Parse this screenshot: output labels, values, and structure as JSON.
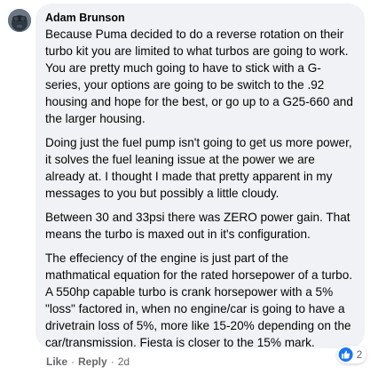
{
  "comment": {
    "author": "Adam Brunson",
    "paragraphs": [
      "Because Puma decided to do a reverse rotation on their turbo kit you are limited to what turbos are going to work. You are pretty much going to have to stick with a G-series, your options are going to be switch to the .92 housing and hope for the best, or go up to a G25-660 and the larger housing.",
      "Doing just the fuel pump isn't going to get us more power, it solves the fuel leaning issue at the power we are already at. I thought I made that pretty apparent in my messages to you but possibly a little cloudy.",
      "Between 30 and 33psi there was ZERO power gain. That means the turbo is maxed out in it's configuration.",
      "The effeciency of the engine is just part of the mathmatical equation for the rated horsepower of a turbo. A 550hp capable turbo is crank horsepower with a 5% \"loss\" factored in, when no engine/car is going to have a drivetrain loss of 5%, more like 15-20% depending on the car/transmission. Fiesta is closer to the 15% mark."
    ],
    "reactions": {
      "icon": "like-thumbs-up-icon",
      "count": "2"
    },
    "actions": {
      "like": "Like",
      "separator": "·",
      "reply": "Reply",
      "time": "2d"
    }
  },
  "colors": {
    "bubble_bg": "#f0f2f5",
    "text": "#050505",
    "secondary_text": "#65676b",
    "like_blue": "#1877f2"
  }
}
